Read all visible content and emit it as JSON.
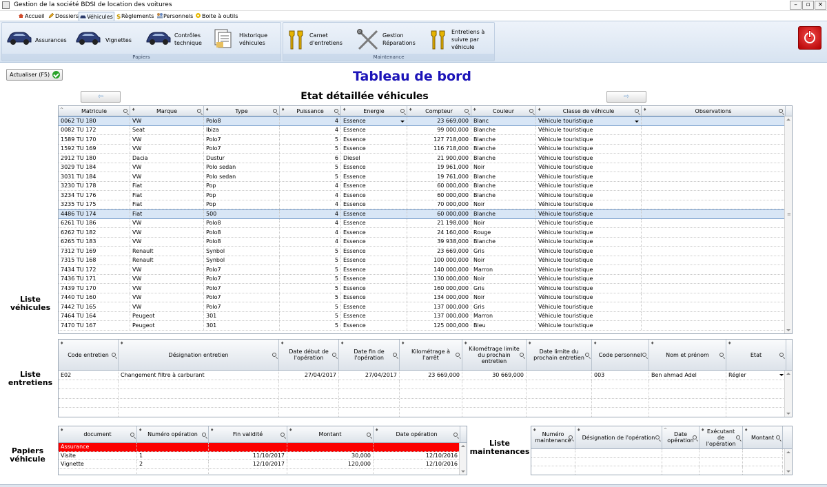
{
  "window": {
    "title": "Gestion de la société BDSI de location des voitures"
  },
  "menu": {
    "items": [
      {
        "label": "Accueil",
        "icon": "home-icon"
      },
      {
        "label": "Dossiers",
        "icon": "edit-icon"
      },
      {
        "label": "Véhicules",
        "icon": "car-icon"
      },
      {
        "label": "Règlements",
        "icon": "dollar-icon"
      },
      {
        "label": "Personnels",
        "icon": "users-icon"
      },
      {
        "label": "Boite à outils",
        "icon": "tools-icon"
      }
    ]
  },
  "ribbon": {
    "papiers": {
      "label": "Papiers",
      "buttons": [
        {
          "label": "Assurances"
        },
        {
          "label": "Vignettes"
        },
        {
          "label": "Contrôles technique"
        },
        {
          "label": "Historique véhicules"
        }
      ]
    },
    "maintenance": {
      "label": "Maintenance",
      "buttons": [
        {
          "label": "Carnet d'entretiens"
        },
        {
          "label": "Gestion Réparations"
        },
        {
          "label": "Entretiens à suivre par véhicule"
        }
      ]
    }
  },
  "toolbar": {
    "refresh_label": "Actualiser (F5)"
  },
  "page": {
    "title": "Tableau de bord",
    "subtitle": "Etat détaillée véhicules"
  },
  "nav": {
    "prev": "⇦",
    "next": "⇨"
  },
  "sections": {
    "vehicules": "Liste véhicules",
    "entretiens": "Liste entretiens",
    "papiers": "Papiers véhicule",
    "maintenances": "Liste maintenances"
  },
  "vehicles": {
    "columns": [
      "Matricule",
      "Marque",
      "Type",
      "Puissance",
      "Energie",
      "Compteur",
      "Couleur",
      "Classe de véhicule",
      "Observations"
    ],
    "rows": [
      [
        "0062 TU 180",
        "VW",
        "Polo8",
        "4",
        "Essence",
        "23 669,000",
        "Blanc",
        "Véhicule touristique",
        ""
      ],
      [
        "0082 TU 172",
        "Seat",
        "Ibiza",
        "4",
        "Essence",
        "99 000,000",
        "Blanche",
        "Véhicule touristique",
        ""
      ],
      [
        "1589 TU 170",
        "VW",
        "Polo7",
        "5",
        "Essence",
        "127 718,000",
        "Blanche",
        "Véhicule touristique",
        ""
      ],
      [
        "1592 TU 169",
        "VW",
        "Polo7",
        "5",
        "Essence",
        "116 718,000",
        "Blanche",
        "Véhicule touristique",
        ""
      ],
      [
        "2912 TU 180",
        "Dacia",
        "Dustur",
        "6",
        "Diesel",
        "21 900,000",
        "Blanche",
        "Véhicule touristique",
        ""
      ],
      [
        "3029 TU 184",
        "VW",
        "Polo sedan",
        "5",
        "Essence",
        "19 961,000",
        "Noir",
        "Véhicule touristique",
        ""
      ],
      [
        "3031 TU 184",
        "VW",
        "Polo sedan",
        "5",
        "Essence",
        "19 761,000",
        "Blanche",
        "Véhicule touristique",
        ""
      ],
      [
        "3230 TU 178",
        "Fiat",
        "Pop",
        "4",
        "Essence",
        "60 000,000",
        "Blanche",
        "Véhicule touristique",
        ""
      ],
      [
        "3234 TU 176",
        "Fiat",
        "Pop",
        "4",
        "Essence",
        "60 000,000",
        "Blanche",
        "Véhicule touristique",
        ""
      ],
      [
        "3235 TU 175",
        "Fiat",
        "Pop",
        "4",
        "Essence",
        "70 000,000",
        "Noir",
        "Véhicule touristique",
        ""
      ],
      [
        "4486 TU 174",
        "Fiat",
        "500",
        "4",
        "Essence",
        "60 000,000",
        "Blanche",
        "Véhicule touristique",
        ""
      ],
      [
        "6261 TU 186",
        "VW",
        "Polo8",
        "4",
        "Essence",
        "21 198,000",
        "Noir",
        "Véhicule touristique",
        ""
      ],
      [
        "6262 TU 182",
        "VW",
        "Polo8",
        "4",
        "Essence",
        "24 160,000",
        "Rouge",
        "Véhicule touristique",
        ""
      ],
      [
        "6265 TU 183",
        "VW",
        "Polo8",
        "4",
        "Essence",
        "39 938,000",
        "Blanche",
        "Véhicule touristique",
        ""
      ],
      [
        "7312 TU 169",
        "Renault",
        "Synbol",
        "5",
        "Essence",
        "23 669,000",
        "Gris",
        "Véhicule touristique",
        ""
      ],
      [
        "7315 TU 168",
        "Renault",
        "Synbol",
        "5",
        "Essence",
        "100 000,000",
        "Noir",
        "Véhicule touristique",
        ""
      ],
      [
        "7434 TU 172",
        "VW",
        "Polo7",
        "5",
        "Essence",
        "140 000,000",
        "Marron",
        "Véhicule touristique",
        ""
      ],
      [
        "7436 TU 171",
        "VW",
        "Polo7",
        "5",
        "Essence",
        "130 000,000",
        "Noir",
        "Véhicule touristique",
        ""
      ],
      [
        "7439 TU 170",
        "VW",
        "Polo7",
        "5",
        "Essence",
        "160 000,000",
        "Gris",
        "Véhicule touristique",
        ""
      ],
      [
        "7440 TU 160",
        "VW",
        "Polo7",
        "5",
        "Essence",
        "134 000,000",
        "Noir",
        "Véhicule touristique",
        ""
      ],
      [
        "7442 TU 165",
        "VW",
        "Polo7",
        "5",
        "Essence",
        "137 000,000",
        "Gris",
        "Véhicule touristique",
        ""
      ],
      [
        "7464 TU 164",
        "Peugeot",
        "301",
        "5",
        "Essence",
        "137 000,000",
        "Marron",
        "Véhicule touristique",
        ""
      ],
      [
        "7470 TU 167",
        "Peugeot",
        "301",
        "5",
        "Essence",
        "125 000,000",
        "Bleu",
        "Véhicule touristique",
        ""
      ]
    ]
  },
  "entretiens": {
    "columns": [
      "Code entretien",
      "Désignation entretien",
      "Date début de l'opération",
      "Date fin de l'opération",
      "Kilométrage à l'arrêt",
      "Kilométrage limite du prochain entretien",
      "Date limite du prochain entretien",
      "Code personnel",
      "Nom et prénom",
      "Etat"
    ],
    "rows": [
      [
        "E02",
        "Changement filtre à carburant",
        "27/04/2017",
        "27/04/2017",
        "23 669,000",
        "30 669,000",
        "",
        "003",
        "Ben ahmad  Adel",
        "Régler"
      ]
    ]
  },
  "papiers": {
    "columns": [
      "document",
      "Numéro opération",
      "Fin validité",
      "Montant",
      "Date opération"
    ],
    "group_row": "Assurance",
    "rows": [
      [
        "Visite",
        "1",
        "11/10/2017",
        "30,000",
        "12/10/2016"
      ],
      [
        "Vignette",
        "2",
        "12/10/2017",
        "120,000",
        "12/10/2016"
      ]
    ]
  },
  "maintenances": {
    "columns": [
      "Numéro maintenance",
      "Désignation de l'opération",
      "Date opération",
      "Exécutant de l'opération",
      "Montant"
    ],
    "rows": []
  },
  "colors": {
    "title": "#1c14b8",
    "group_row": "#fb0000",
    "selection": "#d8e6f6",
    "power": "#cc0000"
  }
}
